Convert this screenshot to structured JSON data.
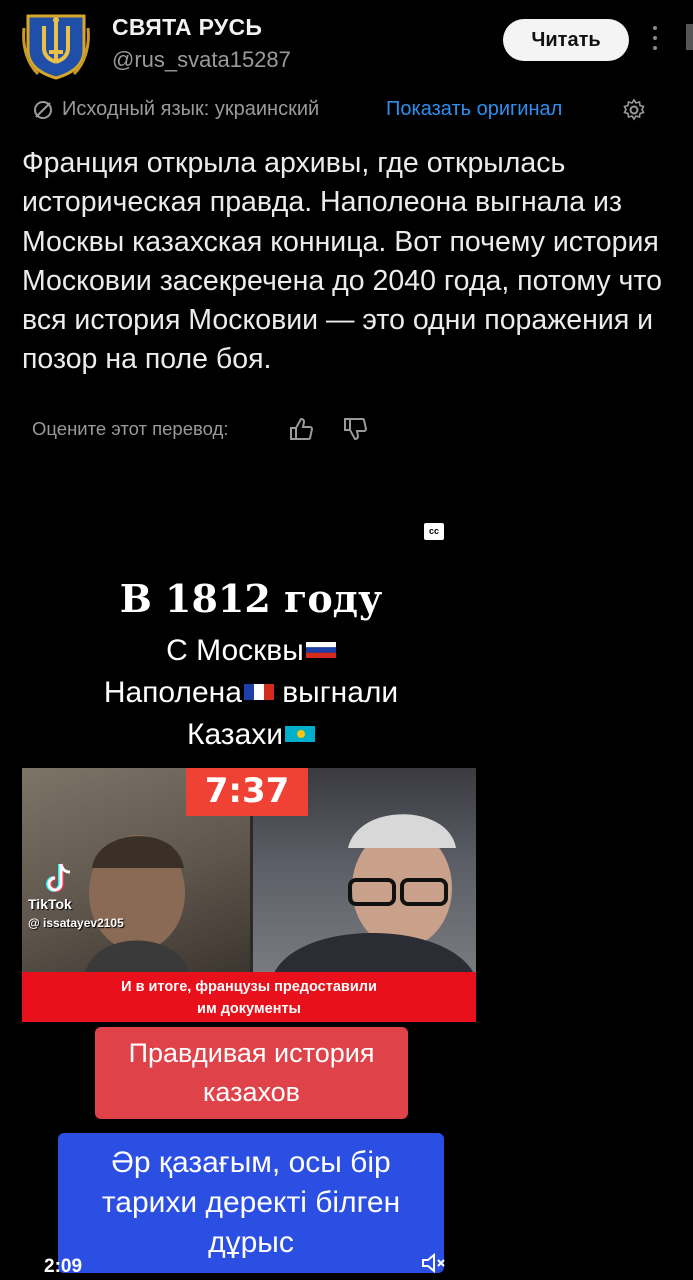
{
  "header": {
    "author_name": "СВЯТА РУСЬ",
    "handle": "@rus_svata15287",
    "read_button": "Читать",
    "avatar_icon": "trident-coat-of-arms-icon",
    "more_icon": "more-vertical-icon"
  },
  "translation": {
    "icon": "translate-icon",
    "source_language": "Исходный язык: украинский",
    "show_original": "Показать оригинал",
    "settings_icon": "gear-icon",
    "link_color": "#2e8ff0"
  },
  "post": {
    "text": "Франция открыла архивы, где открылась историческая правда. Наполеона выгнала из Москвы казахская конница. Вот почему история Московии засекречена до 2040 года, потому что вся история Московии — это одни поражения и позор на поле боя."
  },
  "rating": {
    "label": "Оцените этот перевод:",
    "up_icon": "thumbs-up-icon",
    "down_icon": "thumbs-down-icon"
  },
  "video": {
    "cc_label": "cc",
    "title": "В 1812 году",
    "line1": "С Москвы",
    "line2_a": "Наполена",
    "line2_b": "выгнали",
    "line3": "Казахи",
    "timer": "7:37",
    "tiktok_label": "TikTok",
    "tiktok_user": "@ issatayev2105",
    "caption_line1": "И в итоге, французы предоставили",
    "caption_line2": "им документы",
    "red_bubble_line1": "Правдивая история",
    "red_bubble_line2": "казахов",
    "blue_bubble_line1": "Әр қазағым, осы бір",
    "blue_bubble_line2": "тарихи деректі білген",
    "blue_bubble_line3": "дұрыс",
    "elapsed": "2:09",
    "mute_icon": "speaker-muted-icon",
    "colors": {
      "timer_bg": "#ef4234",
      "caption_bg": "#e8101a",
      "red_bubble": "#e0424a",
      "blue_bubble": "#2b4fe3"
    }
  }
}
